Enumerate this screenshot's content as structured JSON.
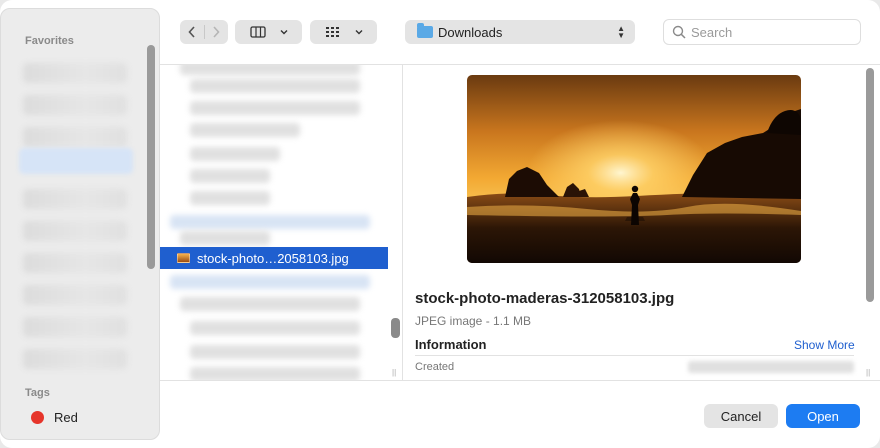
{
  "sidebar": {
    "favorites_heading": "Favorites",
    "tags_heading": "Tags",
    "tags": [
      {
        "label": "Red",
        "color": "#e6352b"
      }
    ]
  },
  "toolbar": {
    "back_icon": "chevron-left-icon",
    "forward_icon": "chevron-right-icon",
    "view_icon": "columns-view-icon",
    "group_icon": "grid-icon",
    "location": "Downloads",
    "search_placeholder": "Search"
  },
  "file_list": {
    "selected_file": "stock-photo…2058103.jpg"
  },
  "preview": {
    "file_name": "stock-photo-maderas-312058103.jpg",
    "file_kind": "JPEG image - 1.1 MB",
    "info_heading": "Information",
    "show_more": "Show More",
    "created_label": "Created"
  },
  "buttons": {
    "cancel": "Cancel",
    "open": "Open"
  },
  "colors": {
    "accent": "#1d7cf2",
    "selection": "#1f5fcf"
  }
}
